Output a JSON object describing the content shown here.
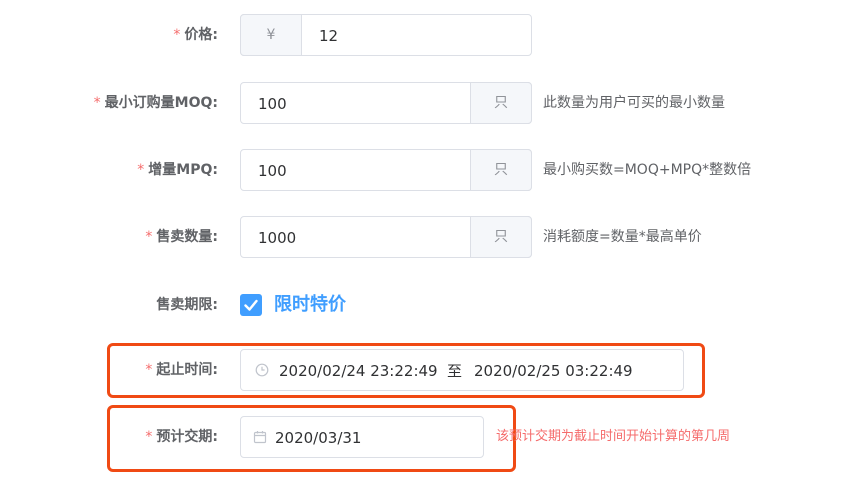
{
  "price": {
    "label": "价格:",
    "prefix": "¥",
    "value": "12"
  },
  "moq": {
    "label": "最小订购量MOQ:",
    "value": "100",
    "unit": "只",
    "hint": "此数量为用户可买的最小数量"
  },
  "mpq": {
    "label": "增量MPQ:",
    "value": "100",
    "unit": "只",
    "hint": "最小购买数=MOQ+MPQ*整数倍"
  },
  "sale_qty": {
    "label": "售卖数量:",
    "value": "1000",
    "unit": "只",
    "hint": "消耗额度=数量*最高单价"
  },
  "sale_period": {
    "label": "售卖期限:",
    "checkbox_label": "限时特价",
    "checked": true
  },
  "time_range": {
    "label": "起止时间:",
    "start": "2020/02/24 23:22:49",
    "separator": "至",
    "end": "2020/02/25 03:22:49"
  },
  "delivery": {
    "label": "预计交期:",
    "value": "2020/03/31",
    "hint": "该预计交期为截止时间开始计算的第几周"
  },
  "required_mark": "*",
  "colors": {
    "accent": "#409eff",
    "required": "#f56c6c",
    "highlight_border": "#f04a14"
  }
}
